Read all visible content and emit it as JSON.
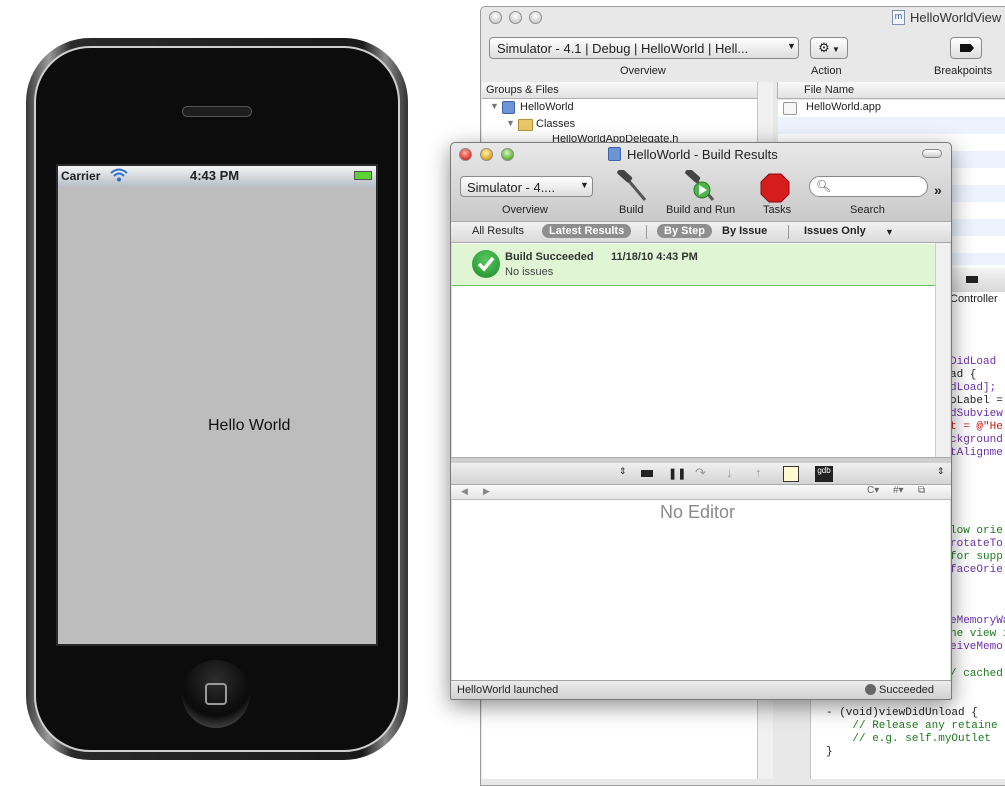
{
  "simulator": {
    "carrier": "Carrier",
    "time": "4:43 PM",
    "screen_text": "Hello World"
  },
  "xcode_main": {
    "title": "HelloWorldView",
    "scheme_popup": "Simulator - 4.1 | Debug | HelloWorld | Hell...",
    "toolbar_labels": {
      "overview": "Overview",
      "action": "Action",
      "breakpoints": "Breakpoints"
    },
    "groups_header": "Groups & Files",
    "tree": [
      {
        "label": "HelloWorld"
      },
      {
        "label": "Classes"
      },
      {
        "label": "HelloWorldAppDelegate.h"
      }
    ],
    "file_header": "File Name",
    "files": [
      "HelloWorld.app"
    ],
    "editor_title_fragment": "Controller",
    "code_fragments": [
      "DidLoad",
      "ad {",
      "dLoad];",
      "oLabel =",
      "dSubview",
      "t = @\"He",
      "ckground",
      "tAlignme",
      "low orie",
      "rotateTo",
      "for supp",
      "faceOrie",
      "eMemoryWa",
      "he view i",
      "eiveMemo",
      "/ cached"
    ],
    "code_bottom": [
      "- (void)viewDidUnload {",
      "    // Release any retaine",
      "    // e.g. self.myOutlet",
      "}"
    ]
  },
  "build_results": {
    "title": "HelloWorld - Build Results",
    "scheme_popup": "Simulator - 4....",
    "toolbar_labels": {
      "overview": "Overview",
      "build": "Build",
      "build_and_run": "Build and Run",
      "tasks": "Tasks",
      "search": "Search"
    },
    "search_placeholder": "",
    "filters": {
      "all": "All Results",
      "latest": "Latest Results",
      "by_step": "By Step",
      "by_issue": "By Issue",
      "issues_only": "Issues Only"
    },
    "result": {
      "title": "Build Succeeded",
      "timestamp": "11/18/10 4:43 PM",
      "subtitle": "No issues"
    },
    "editor_placeholder": "No Editor",
    "status_left": "HelloWorld launched",
    "status_right": "Succeeded"
  },
  "colors": {
    "success_bg": "#dff5d3",
    "success_check": "#2e9a3a",
    "screen_bg": "#bdbdbd"
  }
}
